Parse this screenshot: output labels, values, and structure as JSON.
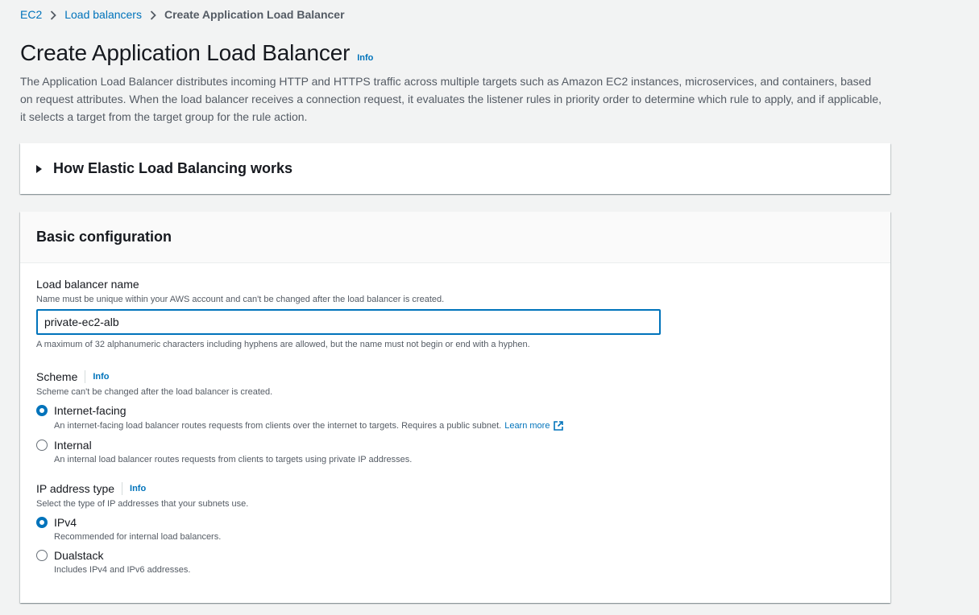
{
  "breadcrumb": {
    "items": [
      "EC2",
      "Load balancers"
    ],
    "current": "Create Application Load Balancer"
  },
  "header": {
    "title": "Create Application Load Balancer",
    "info": "Info",
    "description": "The Application Load Balancer distributes incoming HTTP and HTTPS traffic across multiple targets such as Amazon EC2 instances, microservices, and containers, based on request attributes. When the load balancer receives a connection request, it evaluates the listener rules in priority order to determine which rule to apply, and if applicable, it selects a target from the target group for the rule action."
  },
  "how_it_works": {
    "title": "How Elastic Load Balancing works"
  },
  "basic_config": {
    "title": "Basic configuration",
    "name_field": {
      "label": "Load balancer name",
      "description": "Name must be unique within your AWS account and can't be changed after the load balancer is created.",
      "value": "private-ec2-alb",
      "constraint": "A maximum of 32 alphanumeric characters including hyphens are allowed, but the name must not begin or end with a hyphen."
    },
    "scheme": {
      "label": "Scheme",
      "info": "Info",
      "description": "Scheme can't be changed after the load balancer is created.",
      "options": [
        {
          "label": "Internet-facing",
          "description": "An internet-facing load balancer routes requests from clients over the internet to targets. Requires a public subnet.",
          "link": "Learn more",
          "checked": true
        },
        {
          "label": "Internal",
          "description": "An internal load balancer routes requests from clients to targets using private IP addresses.",
          "checked": false
        }
      ]
    },
    "ip_type": {
      "label": "IP address type",
      "info": "Info",
      "description": "Select the type of IP addresses that your subnets use.",
      "options": [
        {
          "label": "IPv4",
          "description": "Recommended for internal load balancers.",
          "checked": true
        },
        {
          "label": "Dualstack",
          "description": "Includes IPv4 and IPv6 addresses.",
          "checked": false
        }
      ]
    }
  },
  "colors": {
    "link": "#0073bb",
    "background": "#f2f3f3",
    "text": "#16191f",
    "secondary_text": "#545b64"
  }
}
